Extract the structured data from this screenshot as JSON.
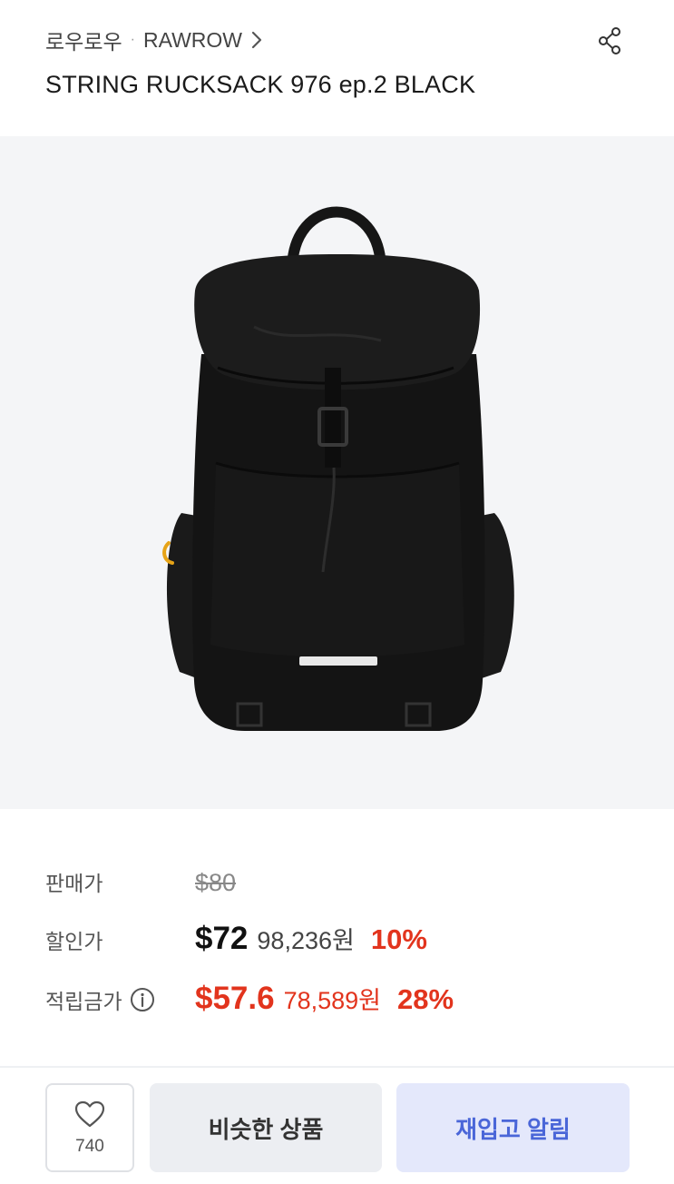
{
  "header": {
    "brand_kr": "로우로우",
    "separator": "·",
    "brand_en": "RAWROW",
    "product_title": "STRING RUCKSACK 976 ep.2 BLACK"
  },
  "prices": {
    "sale_label": "판매가",
    "original_price": "$80",
    "discount_label": "할인가",
    "discount_price": "$72",
    "discount_krw": "98,236원",
    "discount_pct": "10%",
    "points_label": "적립금가",
    "points_price": "$57.6",
    "points_krw": "78,589원",
    "points_pct": "28%"
  },
  "actions": {
    "like_count": "740",
    "similar_label": "비슷한 상품",
    "restock_label": "재입고 알림"
  },
  "colors": {
    "accent_red": "#e2341d",
    "accent_blue": "#4a66d8"
  },
  "icons": [
    "chevron-right-icon",
    "share-icon",
    "heart-icon",
    "info-icon"
  ]
}
